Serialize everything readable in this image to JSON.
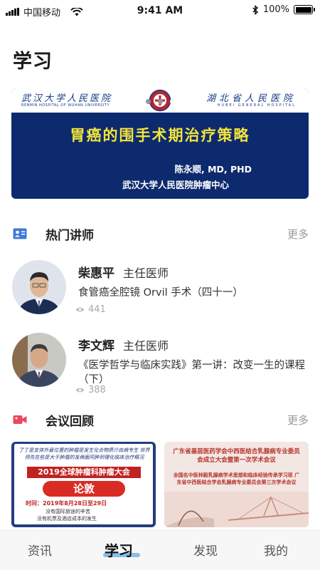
{
  "status_bar": {
    "carrier": "中国移动",
    "time": "9:41 AM",
    "battery": "100%",
    "battery_level": 1.0,
    "icons": [
      "signal-icon",
      "wifi-icon",
      "bluetooth-icon",
      "battery-icon"
    ]
  },
  "page": {
    "title": "学习"
  },
  "banner": {
    "hospital_left": "武汉大学人民医院",
    "hospital_left_en": "RENMIN HOSPITAL OF WUHAN UNIVERSITY",
    "hospital_right": "湖北省人民医院",
    "hospital_right_en": "HUBEI GENERAL HOSPITAL",
    "title": "胃癌的围手术期治疗策略",
    "speaker": "陈永顺, MD, PHD",
    "org": "武汉大学人民医院肿瘤中心",
    "slide_count": 3,
    "active_slide": 3
  },
  "hot_lecturers": {
    "title": "热门讲师",
    "more": "更多",
    "items": [
      {
        "name": "柴惠平",
        "title": "主任医师",
        "course": "食管癌全腔镜 Orvil 手术（四十一）",
        "views": "441"
      },
      {
        "name": "李文辉",
        "title": "主任医师",
        "course": "《医学哲学与临床实践》第一讲：改变一生的课程（下）",
        "views": "388"
      }
    ]
  },
  "meetings": {
    "title": "会议回顾",
    "more": "更多",
    "cards": [
      {
        "slogan": "了丁是支体外最位置的肿瘤是发生化合物质介由病专生 世界领先在些是大于肿瘤的发病面同肿到理化临床治疗概况",
        "title": "2019全球肿瘤科肿瘤大会",
        "forum": "论敦",
        "time": "时间：2019年8月28日至29日",
        "line1": "没有国际旅途的辛苦",
        "line2": "没有机票及酒店成本的发生"
      },
      {
        "title": "广东省基层医药学会中西医结合乳腺病专业委员会成立大会暨第一次学术会议",
        "sub": "全国名中医林毅乳腺病学术思想和临床经验传承学习班 广东省中西医结合学会乳腺病专业委员会第三次学术会议"
      }
    ]
  },
  "tab_bar": {
    "tabs": [
      {
        "label": "资讯"
      },
      {
        "label": "学习"
      },
      {
        "label": "发现"
      },
      {
        "label": "我的"
      }
    ],
    "active": "学习"
  },
  "colors": {
    "banner_bg": "#0d2a6e",
    "banner_title": "#f3e43a",
    "lecturer_icon": "#3e7bd9",
    "meeting_icon": "#e84a5f",
    "tab_underline": "#6ab0e6"
  }
}
